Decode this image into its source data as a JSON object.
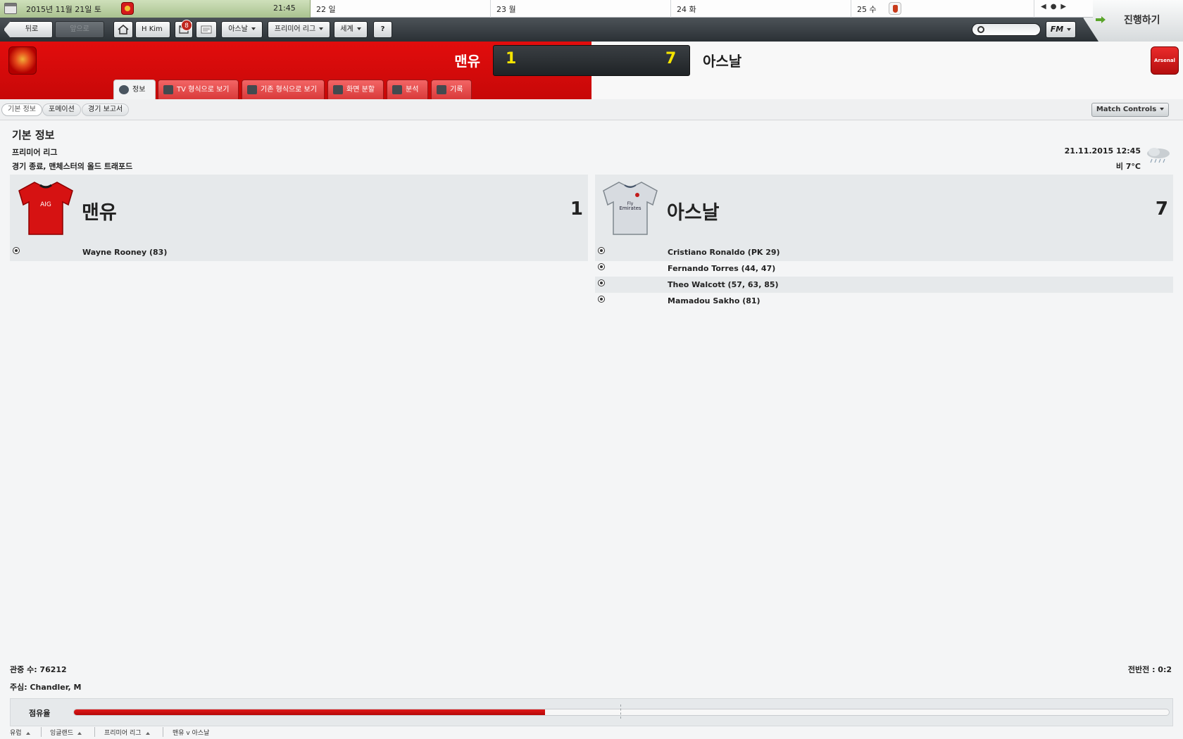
{
  "calendar": {
    "today_date": "2015년 11월 21일 토",
    "today_time": "21:45",
    "days": [
      "22 일",
      "23 월",
      "24 화",
      "25 수"
    ],
    "nav": "◀●▶"
  },
  "toolbar": {
    "back_label": "뒤로",
    "forward_label": "앞으로",
    "manager_label": "H Kim",
    "inbox_count": "8",
    "club_label": "아스날",
    "league_label": "프리미어 리그",
    "world_label": "세계",
    "help_label": "?",
    "fm_label": "FM",
    "continue_label": "진행하기"
  },
  "match": {
    "home_team": "맨유",
    "away_team": "아스날",
    "home_score": "1",
    "away_score": "7",
    "away_badge_text": "Arsenal"
  },
  "tabs": [
    {
      "label": "정보"
    },
    {
      "label": "TV 형식으로 보기"
    },
    {
      "label": "기존 형식으로 보기"
    },
    {
      "label": "화면 분할"
    },
    {
      "label": "분석"
    },
    {
      "label": "기록"
    }
  ],
  "subtabs": [
    {
      "label": "기본 정보"
    },
    {
      "label": "포메이션"
    },
    {
      "label": "경기 보고서"
    }
  ],
  "match_controls_label": "Match Controls",
  "info": {
    "title": "기본 정보",
    "competition": "프리미어 리그",
    "status": "경기 종료, 맨체스터의 올드 트래포드",
    "datetime": "21.11.2015 12:45",
    "weather": "비 7°C",
    "weather_icon": "rain-cloud-icon"
  },
  "home_panel": {
    "name": "맨유",
    "score": "1",
    "goals": [
      "Wayne Rooney (83)"
    ]
  },
  "away_panel": {
    "name": "아스날",
    "score": "7",
    "goals": [
      "Cristiano Ronaldo (PK 29)",
      "Fernando Torres (44, 47)",
      "Theo Walcott (57, 63, 85)",
      "Mamadou Sakho (81)"
    ]
  },
  "footer": {
    "attendance": "관중 수: 76212",
    "referee": "주심: Chandler, M",
    "halftime": "전반전 : 0:2",
    "possession_label": "점유율",
    "possession_home_fraction": 0.43,
    "home_color": "#d10f0f"
  },
  "breadcrumbs": [
    "유럽",
    "잉글랜드",
    "프리미어 리그",
    "맨유 v 아스날"
  ]
}
